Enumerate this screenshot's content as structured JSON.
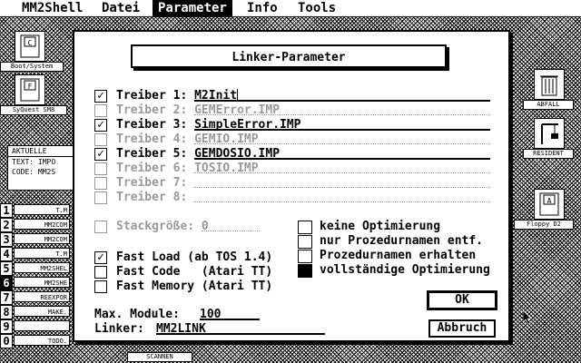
{
  "menubar": {
    "items": [
      {
        "label": "MM2Shell"
      },
      {
        "label": "Datei"
      },
      {
        "label": "Parameter"
      },
      {
        "label": "Info"
      },
      {
        "label": "Tools"
      }
    ],
    "active_index": 2
  },
  "desktop": {
    "boot_label": "Boot/System",
    "syquest_label": "SyQuest SM8",
    "trash_label": "ABFALL",
    "resident_label": "RESIDENT",
    "floppy_label": "Floppy D2",
    "scan_label": "SCANNEN"
  },
  "left_panel": {
    "status_rows": [
      "AKTUELLE",
      "TEXT: IMPO",
      "CODE: MM2S"
    ],
    "slots": [
      {
        "num": "1",
        "name": "T.M"
      },
      {
        "num": "2",
        "name": "MM2COM"
      },
      {
        "num": "3",
        "name": "MM2COM"
      },
      {
        "num": "4",
        "name": "T.M"
      },
      {
        "num": "5",
        "name": "MM2SHEL"
      },
      {
        "num": "6",
        "name": "MM2SHE"
      },
      {
        "num": "7",
        "name": "REEXPOR"
      },
      {
        "num": "8",
        "name": "MAKE."
      },
      {
        "num": "9",
        "name": ""
      },
      {
        "num": "0",
        "name": "TODO."
      }
    ],
    "selected_slot": "6"
  },
  "dialog": {
    "title": "Linker-Parameter",
    "drivers": [
      {
        "label": "Treiber 1:",
        "value": "M2Init",
        "checked": true,
        "enabled": true
      },
      {
        "label": "Treiber 2:",
        "value": "GEMError.IMP",
        "checked": false,
        "enabled": false
      },
      {
        "label": "Treiber 3:",
        "value": "SimpleError.IMP",
        "checked": true,
        "enabled": true
      },
      {
        "label": "Treiber 4:",
        "value": "GEMIO.IMP",
        "checked": false,
        "enabled": false
      },
      {
        "label": "Treiber 5:",
        "value": "GEMDOSIO.IMP",
        "checked": true,
        "enabled": true
      },
      {
        "label": "Treiber 6:",
        "value": "TOSIO.IMP",
        "checked": false,
        "enabled": false
      },
      {
        "label": "Treiber 7:",
        "value": "",
        "checked": false,
        "enabled": false
      },
      {
        "label": "Treiber 8:",
        "value": "",
        "checked": false,
        "enabled": false
      }
    ],
    "stack": {
      "label": "Stackgröße:",
      "value": "0",
      "checked": false,
      "enabled": false
    },
    "options": [
      {
        "label": "Fast Load (ab TOS 1.4)",
        "checked": true
      },
      {
        "label": "Fast Code   (Atari TT)",
        "checked": false
      },
      {
        "label": "Fast Memory (Atari TT)",
        "checked": false
      }
    ],
    "optimization": [
      {
        "label": "keine Optimierung",
        "selected": false
      },
      {
        "label": "nur Prozedurnamen entf.",
        "selected": false
      },
      {
        "label": "Prozedurnamen erhalten",
        "selected": false
      },
      {
        "label": "vollständige Optimierung",
        "selected": true
      }
    ],
    "max_modules": {
      "label": "Max. Module:",
      "value": "100"
    },
    "linker": {
      "label": "Linker:",
      "value": "MM2LINK"
    },
    "ok_label": "OK",
    "cancel_label": "Abbruch",
    "check_glyph": "✓"
  },
  "colors": {
    "foreground": "#000000",
    "background": "#ffffff",
    "disabled": "#999999"
  },
  "icons": {
    "trash": "trash-icon",
    "disk": "disk-icon",
    "cursor": "arrow-cursor-icon"
  }
}
